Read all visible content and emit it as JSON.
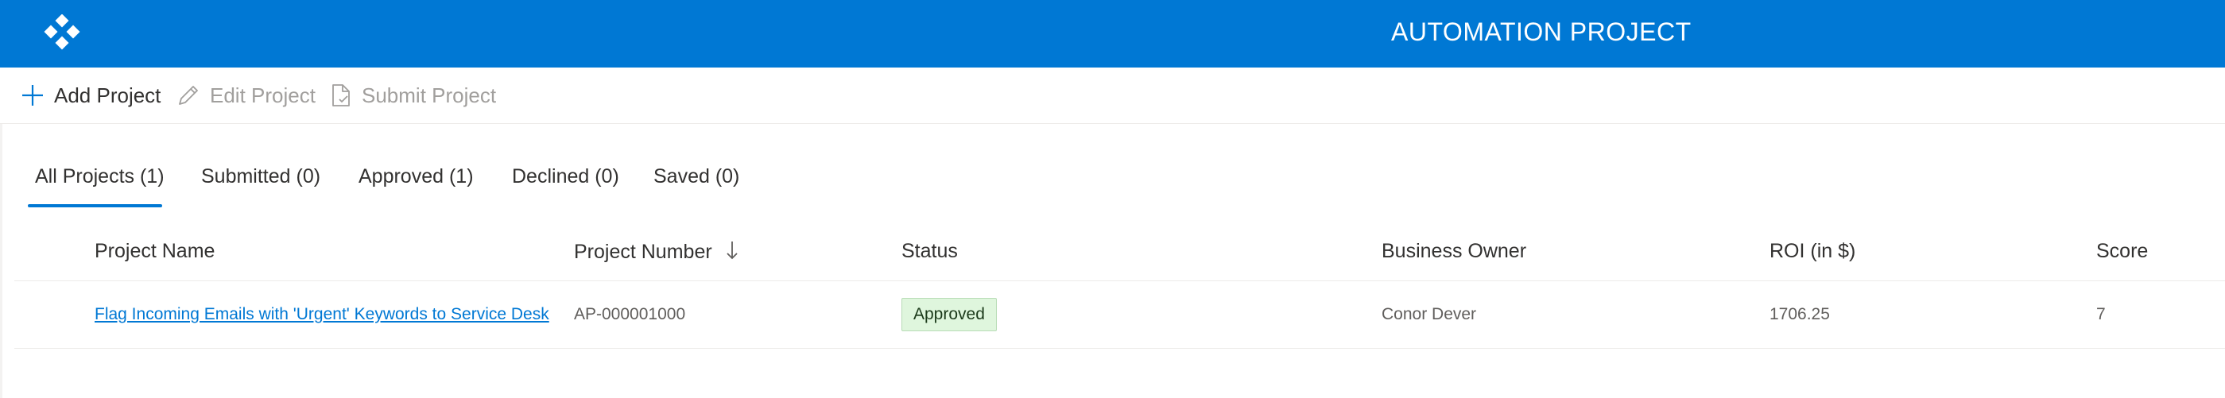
{
  "header": {
    "title": "AUTOMATION PROJECT",
    "background_color": "#0078d4",
    "logo_icon": "app-logo-icon"
  },
  "toolbar": {
    "add_label": "Add Project",
    "edit_label": "Edit Project",
    "submit_label": "Submit Project",
    "add_icon": "plus-icon",
    "edit_icon": "pencil-icon",
    "submit_icon": "document-icon"
  },
  "tabs": [
    {
      "label": "All Projects (1)",
      "active": true
    },
    {
      "label": "Submitted (0)",
      "active": false
    },
    {
      "label": "Approved (1)",
      "active": false
    },
    {
      "label": "Declined (0)",
      "active": false
    },
    {
      "label": "Saved (0)",
      "active": false
    }
  ],
  "table": {
    "columns": [
      {
        "label": "Project Name"
      },
      {
        "label": "Project Number",
        "sort": "descending"
      },
      {
        "label": "Status"
      },
      {
        "label": "Business Owner"
      },
      {
        "label": "ROI (in $)"
      },
      {
        "label": "Score"
      }
    ],
    "rows": [
      {
        "project_name": "Flag Incoming Emails with 'Urgent' Keywords to Service Desk",
        "project_number": "AP-000001000",
        "status": "Approved",
        "business_owner": "Conor Dever",
        "roi": "1706.25",
        "score": "7"
      }
    ]
  },
  "colors": {
    "accent": "#0078d4",
    "approved_badge_bg": "#dff6dd",
    "disabled_text": "#a19f9d"
  }
}
